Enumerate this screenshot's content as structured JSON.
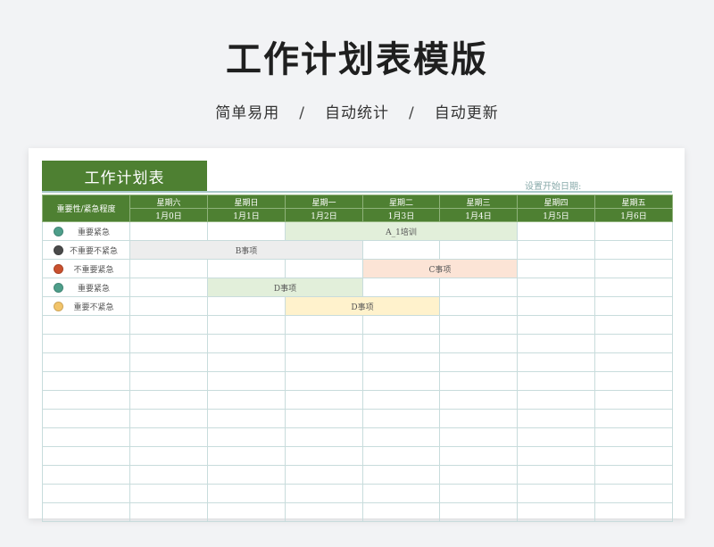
{
  "page": {
    "title": "工作计划表模版",
    "subtitle": [
      "简单易用",
      "自动统计",
      "自动更新"
    ],
    "separator": "/"
  },
  "sheet": {
    "tab_title": "工作计划表",
    "start_date_label": "设置开始日期:",
    "header": {
      "priority_label": "重要性/紧急程度",
      "weekdays": [
        "星期六",
        "星期日",
        "星期一",
        "星期二",
        "星期三",
        "星期四",
        "星期五"
      ],
      "dates": [
        "1月0日",
        "1月1日",
        "1月2日",
        "1月3日",
        "1月4日",
        "1月5日",
        "1月6日"
      ]
    },
    "tasks": [
      {
        "priority": "重要紧急",
        "color": "#4e9e8a",
        "label": "A_1培训",
        "start": 2,
        "span": 3,
        "fill": "#e2efda"
      },
      {
        "priority": "不重要不紧急",
        "color": "#4a4a4a",
        "label": "B事项",
        "start": 0,
        "span": 3,
        "fill": "#ededed"
      },
      {
        "priority": "不重要紧急",
        "color": "#c9512e",
        "label": "C事项",
        "start": 3,
        "span": 2,
        "fill": "#fce4d6"
      },
      {
        "priority": "重要紧急",
        "color": "#4e9e8a",
        "label": "D事项",
        "start": 1,
        "span": 2,
        "fill": "#e2efda"
      },
      {
        "priority": "重要不紧急",
        "color": "#f2c46a",
        "label": "D事项",
        "start": 2,
        "span": 2,
        "fill": "#fff2cc"
      }
    ],
    "empty_rows": 11
  }
}
